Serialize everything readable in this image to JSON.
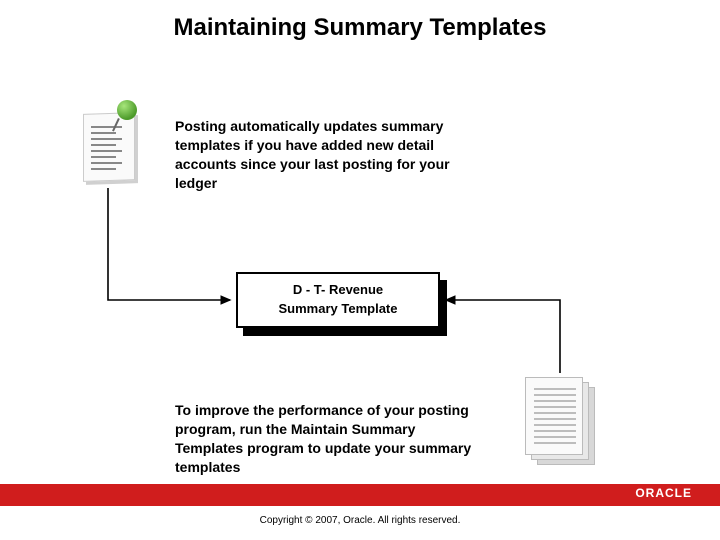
{
  "title": "Maintaining Summary Templates",
  "top_paragraph": "Posting automatically updates summary templates if you have added new detail accounts since your last posting for your ledger",
  "template_box": {
    "line1": "D - T- Revenue",
    "line2": "Summary Template"
  },
  "bottom_paragraph": "To improve the performance of your posting program, run the Maintain Summary Templates program to update your summary templates",
  "footer": {
    "brand": "ORACLE",
    "copyright": "Copyright © 2007, Oracle. All rights reserved."
  },
  "colors": {
    "footer_bar": "#d01d1d",
    "pin": "#4c9a2a"
  }
}
